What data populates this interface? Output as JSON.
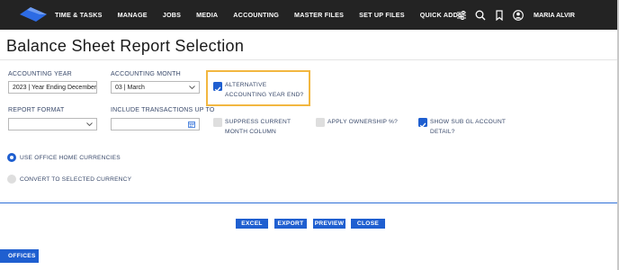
{
  "nav": {
    "menu": [
      "TIME & TASKS",
      "MANAGE",
      "JOBS",
      "MEDIA",
      "ACCOUNTING",
      "MASTER FILES",
      "SET UP FILES",
      "QUICK ADD"
    ],
    "user_name": "MARIA ALVIR"
  },
  "page_title": "Balance Sheet Report Selection",
  "form": {
    "accounting_year": {
      "label": "ACCOUNTING YEAR",
      "value": "2023 | Year Ending December"
    },
    "accounting_month": {
      "label": "ACCOUNTING MONTH",
      "value": "03 | March"
    },
    "alternative_year_end": {
      "label": "ALTERNATIVE ACCOUNTING YEAR END?",
      "checked": true
    },
    "report_format": {
      "label": "REPORT FORMAT",
      "value": ""
    },
    "include_transactions": {
      "label": "INCLUDE TRANSACTIONS UP TO",
      "value": ""
    },
    "suppress_current": {
      "label": "SUPPRESS CURRENT MONTH COLUMN",
      "checked": false
    },
    "apply_ownership": {
      "label": "APPLY OWNERSHIP %?",
      "checked": false
    },
    "show_sub_gl": {
      "label": "SHOW SUB GL ACCOUNT DETAIL?",
      "checked": true
    },
    "currency_options": [
      {
        "label": "USE OFFICE HOME CURRENCIES",
        "selected": true
      },
      {
        "label": "CONVERT TO SELECTED CURRENCY",
        "selected": false
      }
    ]
  },
  "buttons": {
    "excel": "EXCEL",
    "export": "EXPORT",
    "preview": "PREVIEW",
    "close": "CLOSE"
  },
  "tabs": {
    "offices": "OFFICES"
  },
  "colors": {
    "nav_bg": "#232323",
    "accent": "#1f5fd0",
    "highlight": "#f2b740"
  }
}
